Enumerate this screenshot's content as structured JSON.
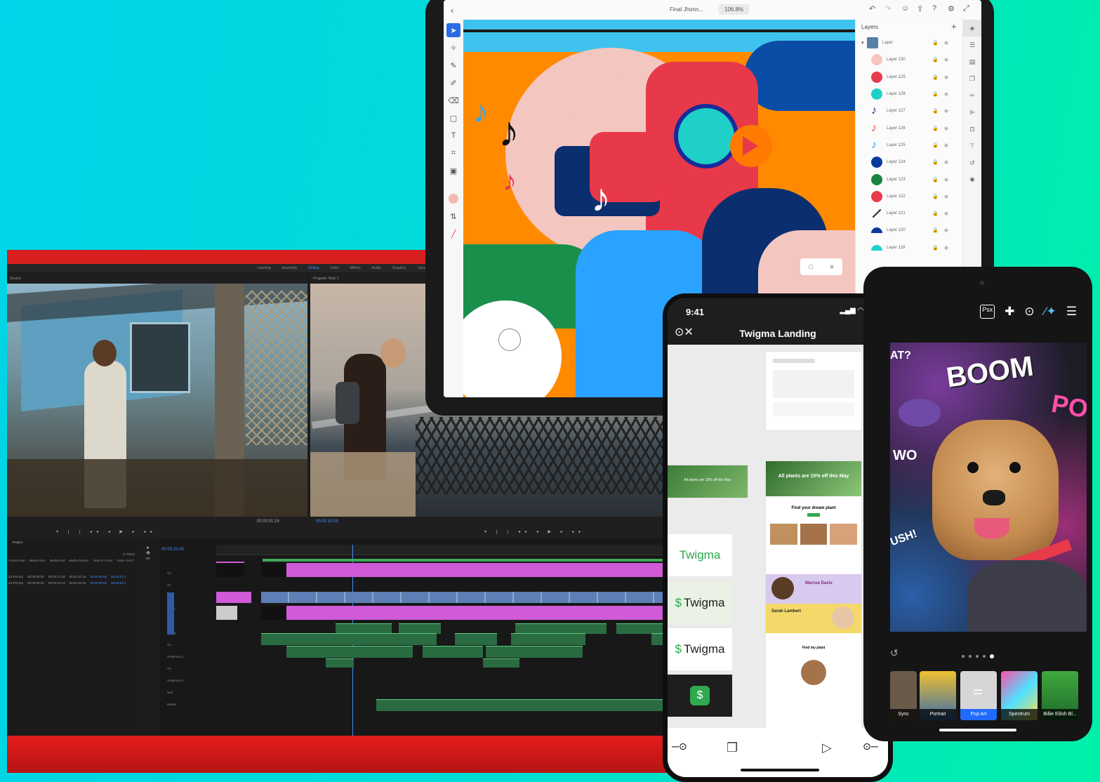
{
  "editor": {
    "workspace_tabs": [
      "Learning",
      "Assembly",
      "Editing",
      "Color",
      "Effects",
      "Audio",
      "Graphics",
      "Libraries"
    ],
    "active_tab": "Editing",
    "program_monitor_label": "Program: Main 1",
    "project_columns": [
      "Frame Rate",
      "Media Start",
      "Media End",
      "Media Duratio",
      "Video In Point",
      "Video Out P"
    ],
    "project_rows": [
      [
        "23.976 fps",
        "00:00:00:00",
        "00:03:17:19",
        "00:01:37:19",
        "00:00:00:00",
        "00:01:37:1"
      ],
      [
        "23.976 fps",
        "00:00:05:00",
        "00:03:24:13",
        "00:01:31:05",
        "00:00:00:00",
        "00:03:04:2"
      ]
    ],
    "items_count": "17 Items",
    "timecode": "00:00:15:09",
    "track_labels": [
      "V3",
      "V2",
      "V1",
      "A1",
      "A2",
      "A3",
      "A4",
      "A5",
      "A6"
    ],
    "track_names": [
      "Music",
      "Dialog",
      "Ambience 1",
      "Ambience 2",
      "Narr",
      "Master"
    ],
    "source_time": "00:00:01:19",
    "program_time": "00:00:15:09"
  },
  "tablet": {
    "doc_title": "Final Jhonn...",
    "zoom": "106.8%",
    "layers_title": "Layers",
    "layers": [
      {
        "name": "Layer",
        "color": "#5a7fa8",
        "shape": "square"
      },
      {
        "name": "Layer 130",
        "color": "#f7c5c0",
        "shape": "circle"
      },
      {
        "name": "Layer 129",
        "color": "#e8394a",
        "shape": "circle"
      },
      {
        "name": "Layer 128",
        "color": "#1fd0c8",
        "shape": "circle"
      },
      {
        "name": "Layer 127",
        "color": "#1a2a9a",
        "shape": "note"
      },
      {
        "name": "Layer 126",
        "color": "#ff3b2f",
        "shape": "note"
      },
      {
        "name": "Layer 125",
        "color": "#29a3ff",
        "shape": "note"
      },
      {
        "name": "Layer 124",
        "color": "#0b3a9e",
        "shape": "circle"
      },
      {
        "name": "Layer 123",
        "color": "#16853e",
        "shape": "circle"
      },
      {
        "name": "Layer 122",
        "color": "#e8394a",
        "shape": "circle"
      },
      {
        "name": "Layer 121",
        "color": "#444444",
        "shape": "line"
      },
      {
        "name": "Layer 120",
        "color": "#0b3a9e",
        "shape": "half"
      },
      {
        "name": "Layer 119",
        "color": "#1fd0c8",
        "shape": "half"
      }
    ]
  },
  "phone": {
    "time": "9:41",
    "title": "Twigma Landing",
    "logos": [
      "Twigma",
      "Twigma",
      "Twigma"
    ],
    "hero_text": "All plants are 15% off this May",
    "section_title": "Find your dream plant",
    "profile_names": [
      "Marcus Davis",
      "Sarah Lambert"
    ],
    "find_title": "Find my plant"
  },
  "photo_editor": {
    "toolbar_icons": [
      "psx-icon",
      "move-icon",
      "play-circle-icon",
      "magic-wand-icon",
      "sliders-icon"
    ],
    "psx_label": "Psx",
    "comic_words": [
      "BOOM",
      "WO",
      "AT?",
      "USH!",
      "PO"
    ],
    "page_dots": 5,
    "active_dot": 4,
    "filters": [
      {
        "label": "Sync"
      },
      {
        "label": "Portrait"
      },
      {
        "label": "Pop Art",
        "selected": true
      },
      {
        "label": "Spectrum"
      },
      {
        "label": "Billie Eilish Bl..."
      }
    ]
  }
}
